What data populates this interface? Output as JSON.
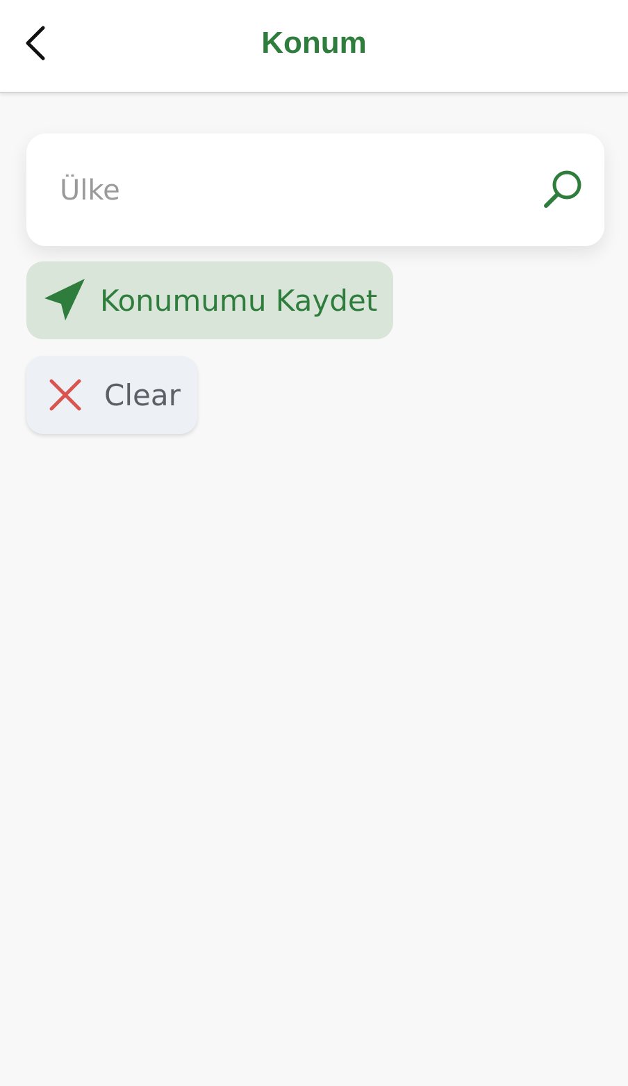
{
  "header": {
    "title": "Konum",
    "back_icon": "chevron-left-icon"
  },
  "search": {
    "placeholder": "Ülke",
    "value": "",
    "icon": "search-icon"
  },
  "actions": {
    "save_location": {
      "label": "Konumumu Kaydet",
      "icon": "navigation-arrow-icon"
    },
    "clear": {
      "label": "Clear",
      "icon": "close-icon"
    }
  },
  "colors": {
    "brand_green": "#2e7d3c",
    "save_chip_bg": "#dae5da",
    "clear_chip_bg": "#edf0f5",
    "clear_icon_red": "#d9534f",
    "page_bg": "#f8f8f8"
  }
}
